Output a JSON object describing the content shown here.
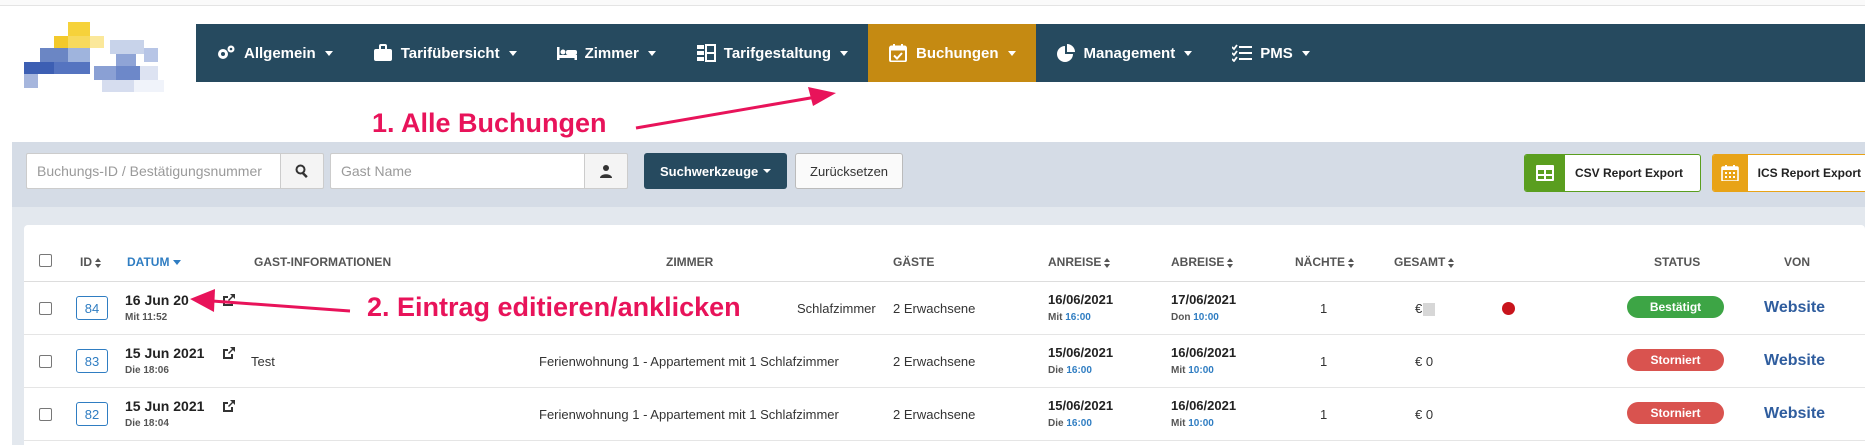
{
  "nav": {
    "items": [
      {
        "label": "Allgemein",
        "icon": "cogs-icon"
      },
      {
        "label": "Tarifübersicht",
        "icon": "briefcase-icon"
      },
      {
        "label": "Zimmer",
        "icon": "bed-icon"
      },
      {
        "label": "Tarifgestaltung",
        "icon": "grid-icon"
      },
      {
        "label": "Buchungen",
        "icon": "calendar-check-icon",
        "active": true
      },
      {
        "label": "Management",
        "icon": "pie-chart-icon"
      },
      {
        "label": "PMS",
        "icon": "list-check-icon"
      }
    ],
    "colors": {
      "bar": "#264a5f",
      "active": "#c58a12"
    }
  },
  "annotations": {
    "step1": "1. Alle Buchungen",
    "step2": "2. Eintrag editieren/anklicken",
    "color": "#e8135a"
  },
  "search": {
    "booking_placeholder": "Buchungs-ID / Bestätigungsnummer",
    "guest_placeholder": "Gast Name",
    "tools_label": "Suchwerkzeuge",
    "reset_label": "Zurücksetzen",
    "csv_label": "CSV Report Export",
    "ics_label": "ICS Report Export"
  },
  "table": {
    "headers": {
      "id": "ID",
      "date": "DATUM",
      "guest_info": "GAST-INFORMATIONEN",
      "room": "ZIMMER",
      "guests": "GÄSTE",
      "arrival": "ANREISE",
      "departure": "ABREISE",
      "nights": "NÄCHTE",
      "total": "GESAMT",
      "status": "STATUS",
      "source": "VON"
    },
    "rows": [
      {
        "id": "84",
        "date": "16 Jun 20",
        "created": "Mit 11:52",
        "guest": "",
        "room": "Schlafzimmer",
        "guests": "2 Erwachsene",
        "arrival_date": "16/06/2021",
        "arrival_day": "Mit",
        "arrival_time": "16:00",
        "departure_date": "17/06/2021",
        "departure_day": "Don",
        "departure_time": "10:00",
        "nights": "1",
        "total": "€",
        "status": "Bestätigt",
        "source": "Website"
      },
      {
        "id": "83",
        "date": "15 Jun 2021",
        "created": "Die 18:06",
        "guest": "Test",
        "room": "Ferienwohnung 1 - Appartement mit 1 Schlafzimmer",
        "guests": "2 Erwachsene",
        "arrival_date": "15/06/2021",
        "arrival_day": "Die",
        "arrival_time": "16:00",
        "departure_date": "16/06/2021",
        "departure_day": "Mit",
        "departure_time": "10:00",
        "nights": "1",
        "total": "€ 0",
        "status": "Storniert",
        "source": "Website"
      },
      {
        "id": "82",
        "date": "15 Jun 2021",
        "created": "Die 18:04",
        "guest": "",
        "room": "Ferienwohnung 1 - Appartement mit 1 Schlafzimmer",
        "guests": "2 Erwachsene",
        "arrival_date": "15/06/2021",
        "arrival_day": "Die",
        "arrival_time": "16:00",
        "departure_date": "16/06/2021",
        "departure_day": "Mit",
        "departure_time": "10:00",
        "nights": "1",
        "total": "€ 0",
        "status": "Storniert",
        "source": "Website"
      }
    ]
  }
}
